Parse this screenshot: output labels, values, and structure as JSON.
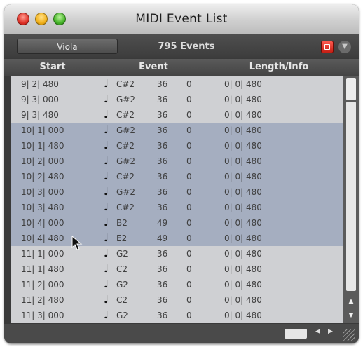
{
  "window": {
    "title": "MIDI Event List"
  },
  "toolbar": {
    "track_name": "Viola",
    "event_count": "795 Events"
  },
  "columns": {
    "start": "Start",
    "event": "Event",
    "length": "Length/Info"
  },
  "rows": [
    {
      "start": "9| 2| 480",
      "pitch": "C#2",
      "vel1": "36",
      "vel2": "0",
      "len": "0| 0| 480",
      "selected": false
    },
    {
      "start": "9| 3| 000",
      "pitch": "G#2",
      "vel1": "36",
      "vel2": "0",
      "len": "0| 0| 480",
      "selected": false
    },
    {
      "start": "9| 3| 480",
      "pitch": "C#2",
      "vel1": "36",
      "vel2": "0",
      "len": "0| 0| 480",
      "selected": false
    },
    {
      "start": "10| 1| 000",
      "pitch": "G#2",
      "vel1": "36",
      "vel2": "0",
      "len": "0| 0| 480",
      "selected": true
    },
    {
      "start": "10| 1| 480",
      "pitch": "C#2",
      "vel1": "36",
      "vel2": "0",
      "len": "0| 0| 480",
      "selected": true
    },
    {
      "start": "10| 2| 000",
      "pitch": "G#2",
      "vel1": "36",
      "vel2": "0",
      "len": "0| 0| 480",
      "selected": true
    },
    {
      "start": "10| 2| 480",
      "pitch": "C#2",
      "vel1": "36",
      "vel2": "0",
      "len": "0| 0| 480",
      "selected": true
    },
    {
      "start": "10| 3| 000",
      "pitch": "G#2",
      "vel1": "36",
      "vel2": "0",
      "len": "0| 0| 480",
      "selected": true
    },
    {
      "start": "10| 3| 480",
      "pitch": "C#2",
      "vel1": "36",
      "vel2": "0",
      "len": "0| 0| 480",
      "selected": true
    },
    {
      "start": "10| 4| 000",
      "pitch": "B2",
      "vel1": "49",
      "vel2": "0",
      "len": "0| 0| 480",
      "selected": true
    },
    {
      "start": "10| 4| 480",
      "pitch": "E2",
      "vel1": "49",
      "vel2": "0",
      "len": "0| 0| 480",
      "selected": true
    },
    {
      "start": "11| 1| 000",
      "pitch": "G2",
      "vel1": "36",
      "vel2": "0",
      "len": "0| 0| 480",
      "selected": false
    },
    {
      "start": "11| 1| 480",
      "pitch": "C2",
      "vel1": "36",
      "vel2": "0",
      "len": "0| 0| 480",
      "selected": false
    },
    {
      "start": "11| 2| 000",
      "pitch": "G2",
      "vel1": "36",
      "vel2": "0",
      "len": "0| 0| 480",
      "selected": false
    },
    {
      "start": "11| 2| 480",
      "pitch": "C2",
      "vel1": "36",
      "vel2": "0",
      "len": "0| 0| 480",
      "selected": false
    },
    {
      "start": "11| 3| 000",
      "pitch": "G2",
      "vel1": "36",
      "vel2": "0",
      "len": "0| 0| 480",
      "selected": false
    }
  ],
  "icons": {
    "note": "quarter-note-icon",
    "record": "record-icon",
    "menu": "chevron-down-icon",
    "cursor": "mouse-pointer-icon"
  },
  "colors": {
    "selection": "#a5aec0",
    "list_bg": "#cfd0d3",
    "record": "#d9261b"
  }
}
